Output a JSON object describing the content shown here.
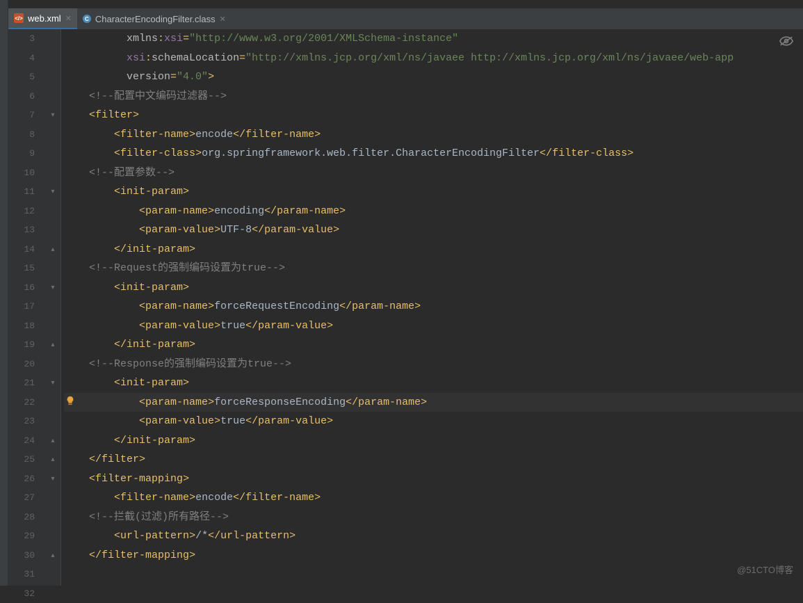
{
  "tabs": [
    {
      "label": "web.xml",
      "active": true,
      "icon": "xml"
    },
    {
      "label": "CharacterEncodingFilter.class",
      "active": false,
      "icon": "class"
    }
  ],
  "watermark": "@51CTO博客",
  "current_line": 22,
  "lines": [
    {
      "n": 3,
      "html": "          <span class='t-attr'>xmlns</span><span class='t-brkt'>:</span><span class='t-ns'>xsi</span><span class='t-brkt'>=</span><span class='t-str'>\"http://www.w3.org/2001/XMLSchema-instance\"</span>"
    },
    {
      "n": 4,
      "html": "          <span class='t-ns'>xsi</span><span class='t-brkt'>:</span><span class='t-attr'>schemaLocation</span><span class='t-brkt'>=</span><span class='t-str'>\"http://xmlns.jcp.org/xml/ns/javaee http://xmlns.jcp.org/xml/ns/javaee/web-app</span>"
    },
    {
      "n": 5,
      "html": "          <span class='t-attr'>version</span><span class='t-brkt'>=</span><span class='t-str'>\"4.0\"</span><span class='t-brkt'>&gt;</span>"
    },
    {
      "n": 6,
      "html": "    <span class='t-comm'>&lt;!--配置中文编码过滤器--&gt;</span>"
    },
    {
      "n": 7,
      "html": "    <span class='t-brkt'>&lt;</span><span class='t-tag'>filter</span><span class='t-brkt'>&gt;</span>"
    },
    {
      "n": 8,
      "html": "        <span class='t-brkt'>&lt;</span><span class='t-tag'>filter-name</span><span class='t-brkt'>&gt;</span><span class='t-txt'>encode</span><span class='t-brkt'>&lt;/</span><span class='t-tag'>filter-name</span><span class='t-brkt'>&gt;</span>"
    },
    {
      "n": 9,
      "html": "        <span class='t-brkt'>&lt;</span><span class='t-tag'>filter-class</span><span class='t-brkt'>&gt;</span><span class='t-txt'>org.springframework.web.filter.CharacterEncodingFilter</span><span class='t-brkt'>&lt;/</span><span class='t-tag'>filter-class</span><span class='t-brkt'>&gt;</span>"
    },
    {
      "n": 10,
      "html": "    <span class='t-comm'>&lt;!--配置参数--&gt;</span>"
    },
    {
      "n": 11,
      "html": "        <span class='t-brkt'>&lt;</span><span class='t-tag'>init-param</span><span class='t-brkt'>&gt;</span>"
    },
    {
      "n": 12,
      "html": "            <span class='t-brkt'>&lt;</span><span class='t-tag'>param-name</span><span class='t-brkt'>&gt;</span><span class='t-txt'>encoding</span><span class='t-brkt'>&lt;/</span><span class='t-tag'>param-name</span><span class='t-brkt'>&gt;</span>"
    },
    {
      "n": 13,
      "html": "            <span class='t-brkt'>&lt;</span><span class='t-tag'>param-value</span><span class='t-brkt'>&gt;</span><span class='t-txt'>UTF-8</span><span class='t-brkt'>&lt;/</span><span class='t-tag'>param-value</span><span class='t-brkt'>&gt;</span>"
    },
    {
      "n": 14,
      "html": "        <span class='t-brkt'>&lt;/</span><span class='t-tag'>init-param</span><span class='t-brkt'>&gt;</span>"
    },
    {
      "n": 15,
      "html": "    <span class='t-comm'>&lt;!--Request的强制编码设置为true--&gt;</span>"
    },
    {
      "n": 16,
      "html": "        <span class='t-brkt'>&lt;</span><span class='t-tag'>init-param</span><span class='t-brkt'>&gt;</span>"
    },
    {
      "n": 17,
      "html": "            <span class='t-brkt'>&lt;</span><span class='t-tag'>param-name</span><span class='t-brkt'>&gt;</span><span class='t-txt'>forceRequestEncoding</span><span class='t-brkt'>&lt;/</span><span class='t-tag'>param-name</span><span class='t-brkt'>&gt;</span>"
    },
    {
      "n": 18,
      "html": "            <span class='t-brkt'>&lt;</span><span class='t-tag'>param-value</span><span class='t-brkt'>&gt;</span><span class='t-txt'>true</span><span class='t-brkt'>&lt;/</span><span class='t-tag'>param-value</span><span class='t-brkt'>&gt;</span>"
    },
    {
      "n": 19,
      "html": "        <span class='t-brkt'>&lt;/</span><span class='t-tag'>init-param</span><span class='t-brkt'>&gt;</span>"
    },
    {
      "n": 20,
      "html": "    <span class='t-comm'>&lt;!--Response的强制编码设置为true--&gt;</span>"
    },
    {
      "n": 21,
      "html": "        <span class='t-brkt'>&lt;</span><span class='t-tag'>init-param</span><span class='t-brkt'>&gt;</span>"
    },
    {
      "n": 22,
      "html": "            <span class='t-brkt'>&lt;</span><span class='t-tag'>param-name</span><span class='t-brkt'>&gt;</span><span class='t-txt'>forceResponseEncoding</span><span class='t-brkt'>&lt;/</span><span class='t-tag'>param-name</span><span class='t-brkt'>&gt;</span>",
      "highlighted": true
    },
    {
      "n": 23,
      "html": "            <span class='t-brkt'>&lt;</span><span class='t-tag'>param-value</span><span class='t-brkt'>&gt;</span><span class='t-txt'>true</span><span class='t-brkt'>&lt;/</span><span class='t-tag'>param-value</span><span class='t-brkt'>&gt;</span>"
    },
    {
      "n": 24,
      "html": "        <span class='t-brkt'>&lt;/</span><span class='t-tag'>init-param</span><span class='t-brkt'>&gt;</span>"
    },
    {
      "n": 25,
      "html": "    <span class='t-brkt'>&lt;/</span><span class='t-tag'>filter</span><span class='t-brkt'>&gt;</span>"
    },
    {
      "n": 26,
      "html": "    <span class='t-brkt'>&lt;</span><span class='t-tag'>filter-mapping</span><span class='t-brkt'>&gt;</span>"
    },
    {
      "n": 27,
      "html": "        <span class='t-brkt'>&lt;</span><span class='t-tag'>filter-name</span><span class='t-brkt'>&gt;</span><span class='t-txt'>encode</span><span class='t-brkt'>&lt;/</span><span class='t-tag'>filter-name</span><span class='t-brkt'>&gt;</span>"
    },
    {
      "n": 28,
      "html": "    <span class='t-comm'>&lt;!--拦截(过滤)所有路径--&gt;</span>"
    },
    {
      "n": 29,
      "html": "        <span class='t-brkt'>&lt;</span><span class='t-tag'>url-pattern</span><span class='t-brkt'>&gt;</span><span class='t-txt'>/*</span><span class='t-brkt'>&lt;/</span><span class='t-tag'>url-pattern</span><span class='t-brkt'>&gt;</span>"
    },
    {
      "n": 30,
      "html": "    <span class='t-brkt'>&lt;/</span><span class='t-tag'>filter-mapping</span><span class='t-brkt'>&gt;</span>"
    },
    {
      "n": 31,
      "html": ""
    },
    {
      "n": 32,
      "html": ""
    }
  ],
  "fold_marks": {
    "7": "▾",
    "11": "▾",
    "14": "▴",
    "16": "▾",
    "19": "▴",
    "21": "▾",
    "24": "▴",
    "25": "▴",
    "26": "▾",
    "30": "▴"
  }
}
